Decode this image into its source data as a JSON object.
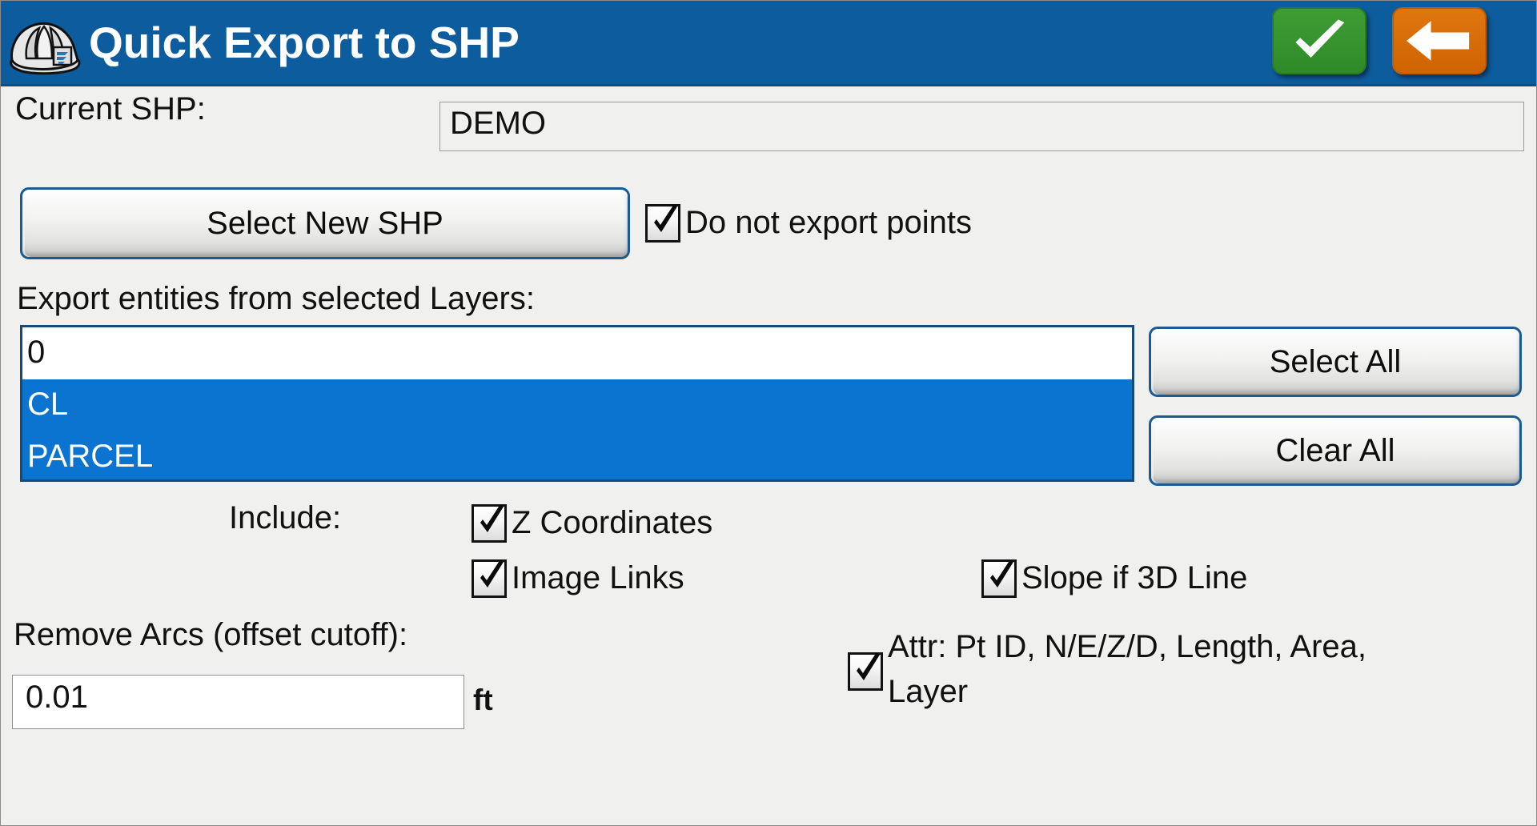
{
  "window": {
    "title": "Quick Export to SHP",
    "icon": "hard-hat-icon",
    "accent_blue": "#0d5c9e",
    "confirm_color": "#3f9d35",
    "back_color": "#df7710"
  },
  "titlebar_buttons": {
    "confirm": {
      "name": "checkmark-icon",
      "label": ""
    },
    "back": {
      "name": "left-arrow-icon",
      "label": ""
    }
  },
  "current_shp": {
    "label": "Current SHP:",
    "value": "DEMO"
  },
  "select_new_shp": {
    "label": "Select New SHP"
  },
  "do_not_export_points": {
    "label": "Do not export points",
    "checked": true
  },
  "layers": {
    "label": "Export entities from selected Layers:",
    "items": [
      {
        "name": "0",
        "selected": false
      },
      {
        "name": "CL",
        "selected": true
      },
      {
        "name": "PARCEL",
        "selected": true
      }
    ],
    "select_all_label": "Select All",
    "clear_all_label": "Clear All",
    "selection_color": "#0a74d0"
  },
  "include": {
    "label": "Include:",
    "options": [
      {
        "label": "Z Coordinates",
        "checked": true
      },
      {
        "label": "Image Links",
        "checked": true
      },
      {
        "label": "Slope if 3D Line",
        "checked": true
      },
      {
        "label": "Attr: Pt ID, N/E/Z/D, Length, Area, Layer",
        "checked": true
      }
    ]
  },
  "remove_arcs": {
    "label": "Remove Arcs (offset cutoff):",
    "value": "0.01",
    "placeholder": "",
    "unit": "ft"
  }
}
